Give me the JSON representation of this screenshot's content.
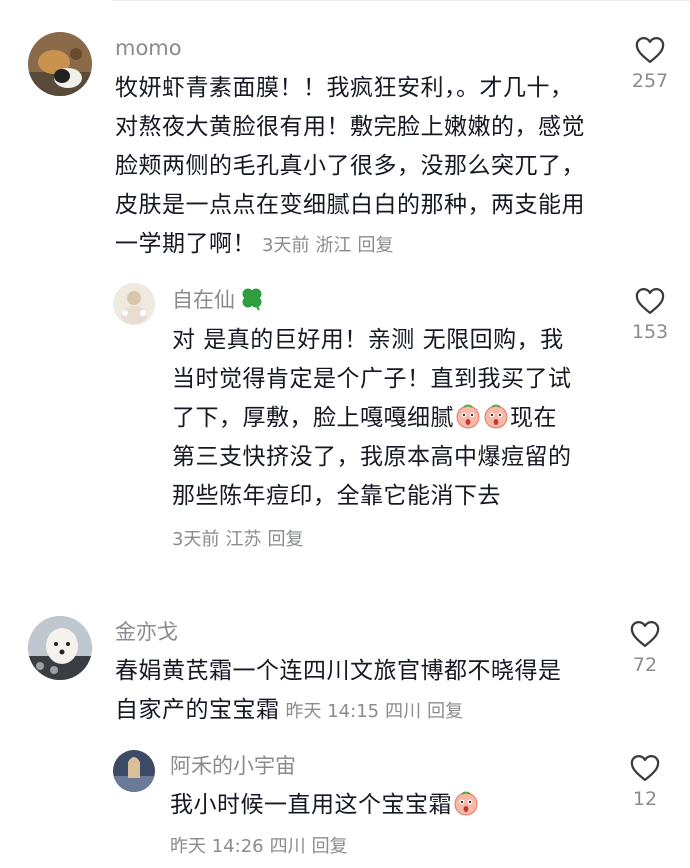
{
  "comments": [
    {
      "user": "momo",
      "lines": [
        "牧妍虾青素面膜！！我疯狂安利，。才几十，",
        "对熬夜大黄脸很有用！敷完脸上嫩嫩的，感觉",
        "脸颊两侧的毛孔真小了很多，没那么突兀了，",
        "皮肤是一点点在变细腻白白的那种，两支能用",
        "一学期了啊！"
      ],
      "time": "3天前",
      "location": "浙江",
      "reply": "回复",
      "likes": "257"
    },
    {
      "user": "自在仙",
      "lines": [
        "对 是真的巨好用！亲测 无限回购，我",
        "当时觉得肯定是个广子！直到我买了试",
        "了下，厚敷，脸上嘎嘎细腻",
        "现在",
        "第三支快挤没了，我原本高中爆痘留的",
        "那些陈年痘印，全靠它能消下去"
      ],
      "time": "3天前",
      "location": "江苏",
      "reply": "回复",
      "likes": "153"
    },
    {
      "user": "金亦戈",
      "lines": [
        "春娟黄芪霜一个连四川文旅官博都不晓得是",
        "自家产的宝宝霜"
      ],
      "time": "昨天 14:15",
      "location": "四川",
      "reply": "回复",
      "likes": "72"
    },
    {
      "user": "阿禾的小宇宙",
      "lines": [
        "我小时候一直用这个宝宝霜"
      ],
      "time": "昨天 14:26",
      "location": "四川",
      "reply": "回复",
      "likes": "12"
    }
  ],
  "colors": {
    "text": "#161823",
    "secondary": "#8a8b91",
    "background": "#ffffff"
  },
  "icons": {
    "like": "heart-outline-icon",
    "emoji": "scared-face-emoji",
    "badge": "clover-icon"
  }
}
